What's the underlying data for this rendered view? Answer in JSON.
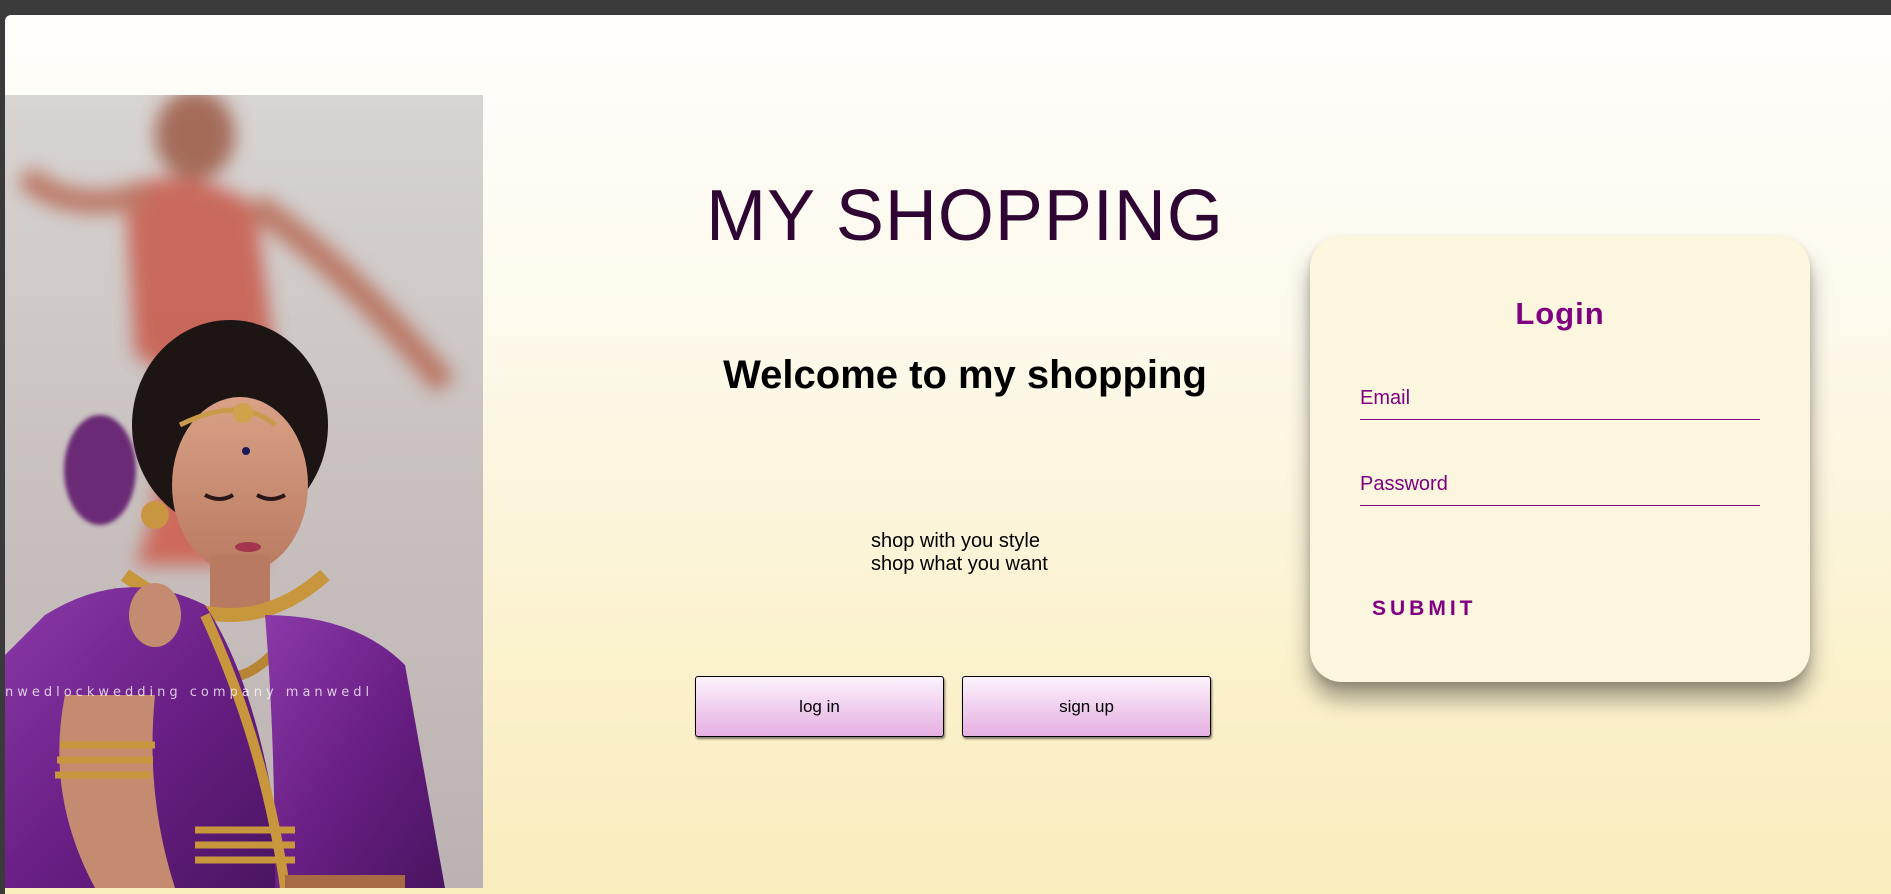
{
  "site": {
    "title": "MY SHOPPING",
    "welcome": "Welcome to my shopping",
    "tagline_line1": "shop with you style",
    "tagline_line2": "shop what you want"
  },
  "hero": {
    "image_name": "bride-in-purple-saree-photo",
    "watermark": "nwedlockwedding company manwedl"
  },
  "buttons": {
    "login_label": "log in",
    "signup_label": "sign up"
  },
  "login_card": {
    "title": "Login",
    "email_placeholder": "Email",
    "password_placeholder": "Password",
    "submit_label": "SUBMIT"
  },
  "colors": {
    "accent": "#800080",
    "title_color": "#2f0533",
    "button_gradient_end": "#e5b0e2",
    "page_background_bottom": "#f9ecbd"
  }
}
